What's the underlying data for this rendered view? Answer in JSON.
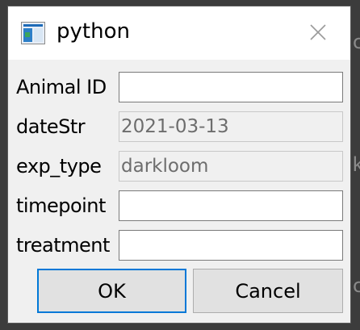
{
  "window": {
    "title": "python"
  },
  "form": {
    "fields": [
      {
        "label": "Animal ID",
        "value": "",
        "readonly": false
      },
      {
        "label": "dateStr",
        "value": "2021-03-13",
        "readonly": true
      },
      {
        "label": "exp_type",
        "value": "darkloom",
        "readonly": true
      },
      {
        "label": "timepoint",
        "value": "",
        "readonly": false
      },
      {
        "label": "treatment",
        "value": "",
        "readonly": false
      }
    ]
  },
  "buttons": {
    "ok": "OK",
    "cancel": "Cancel"
  },
  "background": {
    "glyphs": [
      "c",
      "k",
      "c"
    ]
  },
  "icons": {
    "app": "python-app-icon",
    "close": "close-icon"
  }
}
